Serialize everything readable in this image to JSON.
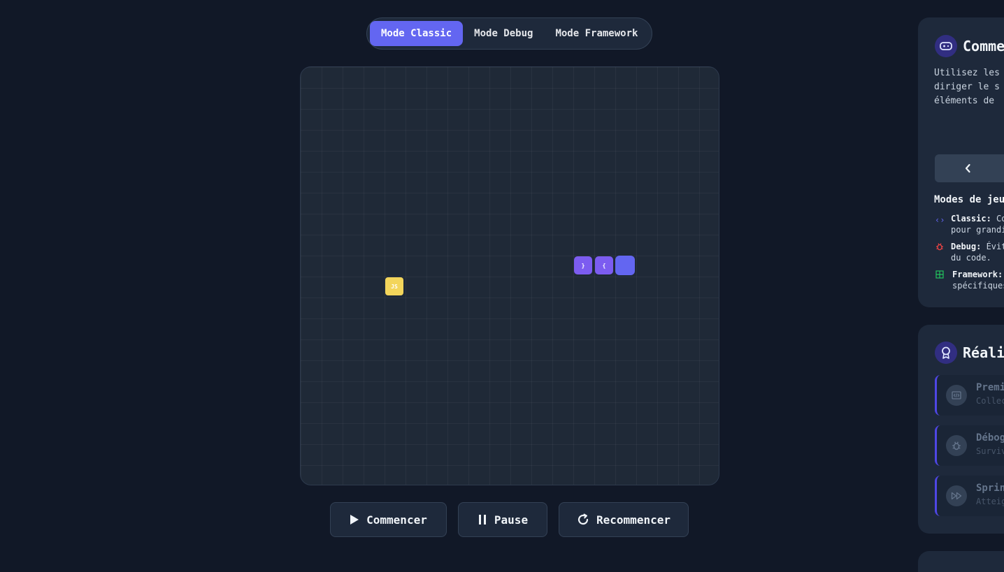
{
  "modes": [
    {
      "label": "Mode Classic",
      "active": true
    },
    {
      "label": "Mode Debug",
      "active": false
    },
    {
      "label": "Mode Framework",
      "active": false
    }
  ],
  "board": {
    "snake": [
      {
        "label": "}"
      },
      {
        "label": "{"
      },
      {
        "label": ""
      }
    ],
    "food": {
      "label": "JS"
    }
  },
  "controls": {
    "start_label": "Commencer",
    "pause_label": "Pause",
    "restart_label": "Recommencer"
  },
  "howto": {
    "title": "Comme",
    "desc_lines": [
      "Utilisez les",
      "diriger le s",
      "éléments de"
    ],
    "modes_title": "Modes de jeu",
    "items": [
      {
        "name": "Classic:",
        "line1": " Co",
        "line2": "pour grandi"
      },
      {
        "name": "Debug:",
        "line1": " Évit",
        "line2": "du code."
      },
      {
        "name": "Framework:",
        "line1": "",
        "line2": "spécifiques"
      }
    ]
  },
  "achievements": {
    "title": "Réali",
    "items": [
      {
        "name": "Premi",
        "desc": "Collec",
        "icon": "code-icon"
      },
      {
        "name": "Débog",
        "desc": "Surviv",
        "icon": "bug-icon"
      },
      {
        "name": "Sprin",
        "desc": "Atteig",
        "icon": "fast-forward-icon"
      }
    ]
  },
  "colors": {
    "accent": "#6366f1",
    "snake_body": "#7c5cf0",
    "food": "#f3d55b",
    "background": "#111827",
    "board": "#1f2937"
  }
}
